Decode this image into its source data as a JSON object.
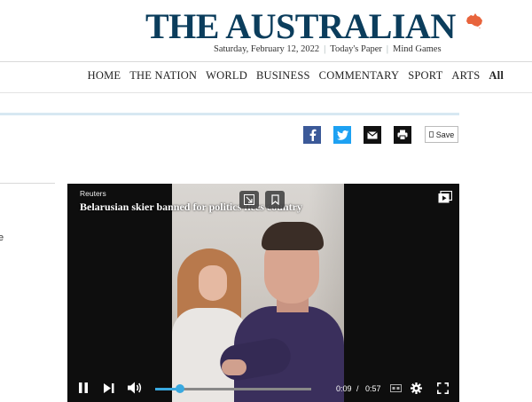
{
  "masthead": {
    "logo": "THE AUSTRALIAN",
    "date": "Saturday, February 12, 2022",
    "links": [
      "Today's Paper",
      "Mind Games"
    ]
  },
  "nav": {
    "items": [
      {
        "label": "HOME",
        "bold": false
      },
      {
        "label": "THE NATION",
        "bold": false
      },
      {
        "label": "WORLD",
        "bold": false
      },
      {
        "label": "BUSINESS",
        "bold": false
      },
      {
        "label": "COMMENTARY",
        "bold": false
      },
      {
        "label": "SPORT",
        "bold": false
      },
      {
        "label": "ARTS",
        "bold": false
      },
      {
        "label": "All",
        "bold": true
      }
    ]
  },
  "share": {
    "save_label": "Save",
    "icons": [
      "facebook-icon",
      "twitter-icon",
      "email-icon",
      "print-icon"
    ]
  },
  "left_fragment": "e",
  "video": {
    "source": "Reuters",
    "title": "Belarusian skier banned for politics flees country",
    "current_time": "0:09",
    "separator": "/",
    "duration": "0:57",
    "progress": 0.16
  },
  "colors": {
    "logo": "#0b3d5c",
    "map": "#e8643c",
    "facebook": "#3b5998",
    "twitter": "#1da1f2",
    "progress": "#39a9e0"
  }
}
